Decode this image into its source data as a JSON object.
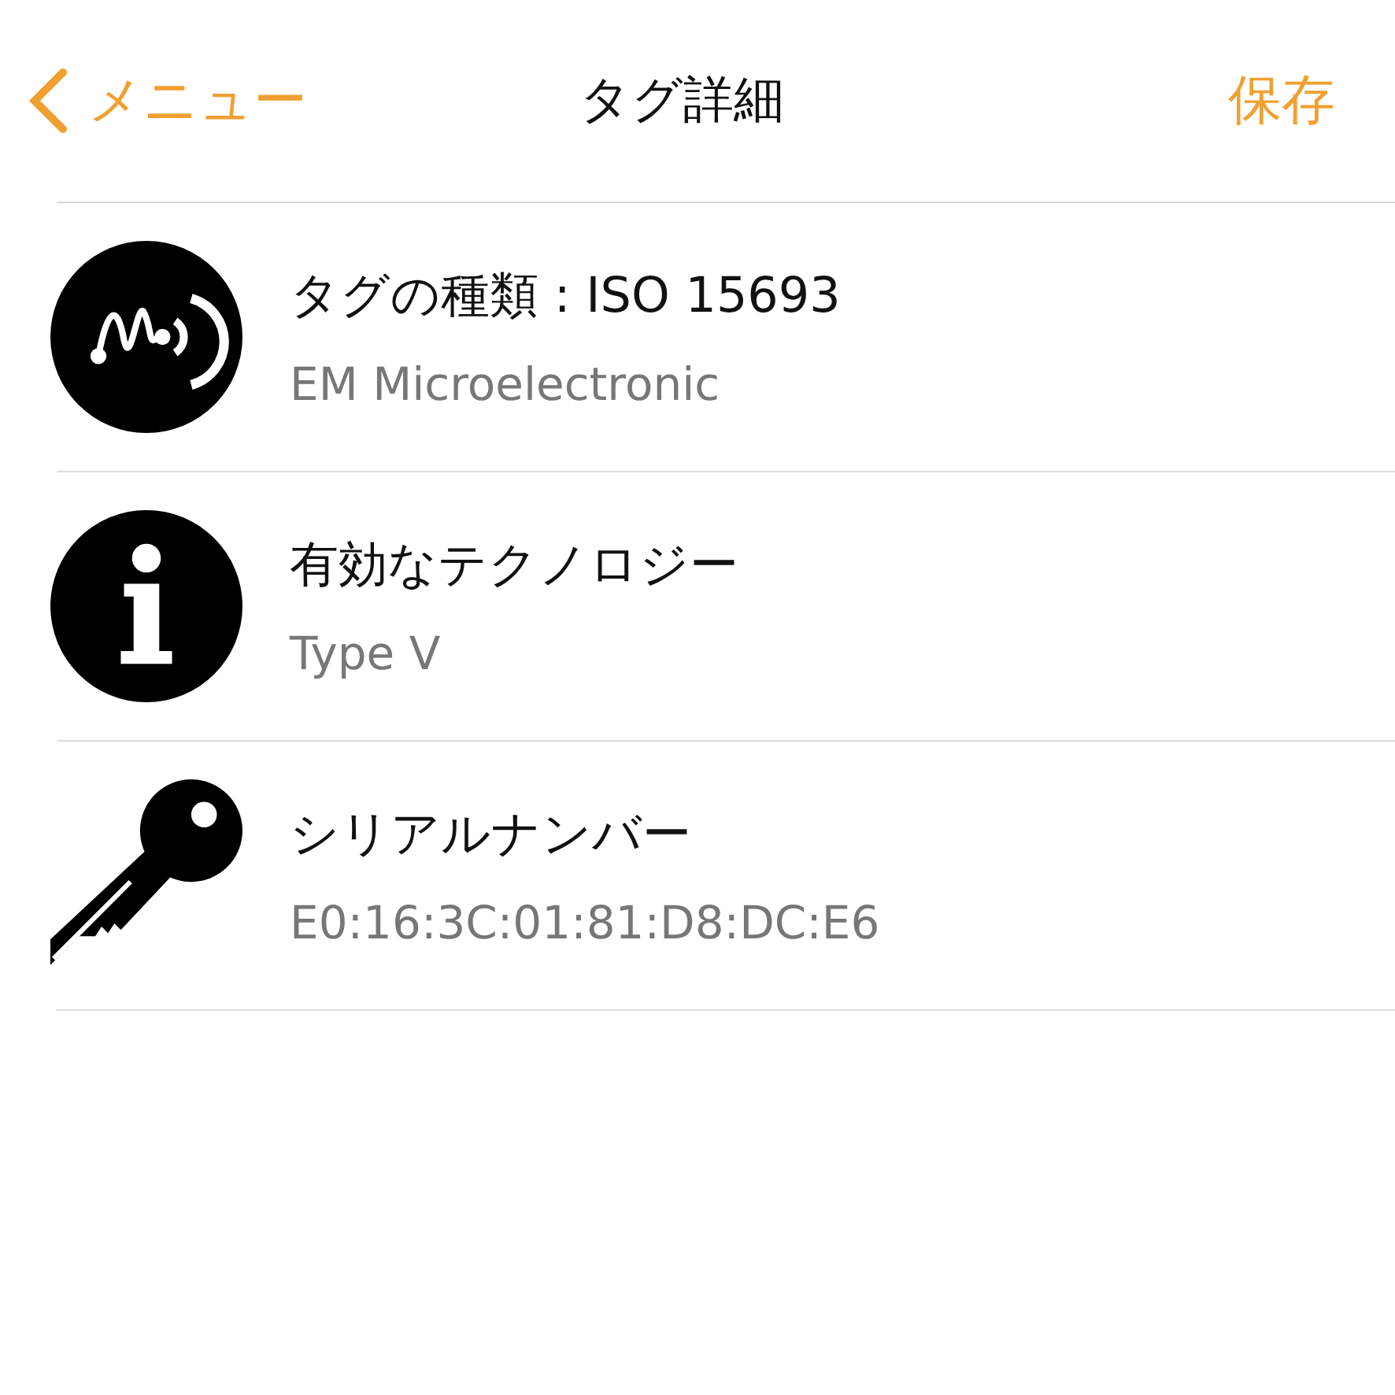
{
  "nav": {
    "back": "メニュー",
    "title": "タグ詳細",
    "action": "保存"
  },
  "items": [
    {
      "kind": "nfc",
      "title": "タグの種類 : ISO 15693",
      "value": "EM Microelectronic"
    },
    {
      "kind": "info",
      "title": "有効なテクノロジー",
      "value": "Type V"
    },
    {
      "kind": "key",
      "title": "シリアルナンバー",
      "value": "E0:16:3C:01:81:D8:DC:E6"
    }
  ]
}
